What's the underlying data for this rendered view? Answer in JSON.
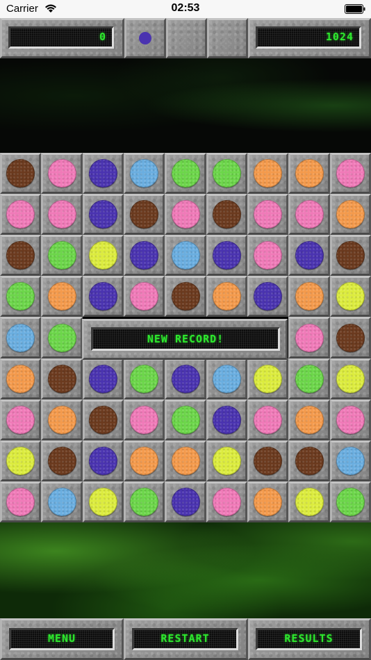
{
  "status": {
    "carrier": "Carrier",
    "time": "02:53"
  },
  "score": "0",
  "high_score": "1024",
  "next_piece": {
    "color": "purple"
  },
  "banner": "NEW RECORD!",
  "buttons": {
    "menu": "MENU",
    "restart": "RESTART",
    "results": "RESULTS"
  },
  "colors": {
    "brown": "#6b3a1e",
    "pink": "#f07ab8",
    "purple": "#4a33b0",
    "blue": "#6aaee0",
    "green": "#6cd64a",
    "orange": "#f49a4c",
    "yellow": "#dcec3e",
    "lcd_text": "#2ee82e"
  },
  "board": [
    [
      "brown",
      "pink",
      "purple",
      "blue",
      "green",
      "green",
      "orange",
      "orange",
      "pink"
    ],
    [
      "pink",
      "pink",
      "purple",
      "brown",
      "pink",
      "brown",
      "pink",
      "pink",
      "orange"
    ],
    [
      "brown",
      "green",
      "yellow",
      "purple",
      "blue",
      "purple",
      "pink",
      "purple",
      "brown"
    ],
    [
      "green",
      "orange",
      "purple",
      "pink",
      "brown",
      "orange",
      "purple",
      "orange",
      "yellow"
    ],
    [
      "blue",
      "green",
      null,
      null,
      null,
      null,
      null,
      "pink",
      "brown"
    ],
    [
      "orange",
      "brown",
      "purple",
      "green",
      "purple",
      "blue",
      "yellow",
      "green",
      "yellow"
    ],
    [
      "pink",
      "orange",
      "brown",
      "pink",
      "green",
      "purple",
      "pink",
      "orange",
      "pink"
    ],
    [
      "yellow",
      "brown",
      "purple",
      "orange",
      "orange",
      "yellow",
      "brown",
      "brown",
      "blue"
    ],
    [
      "pink",
      "blue",
      "yellow",
      "green",
      "purple",
      "pink",
      "orange",
      "yellow",
      "green"
    ]
  ]
}
